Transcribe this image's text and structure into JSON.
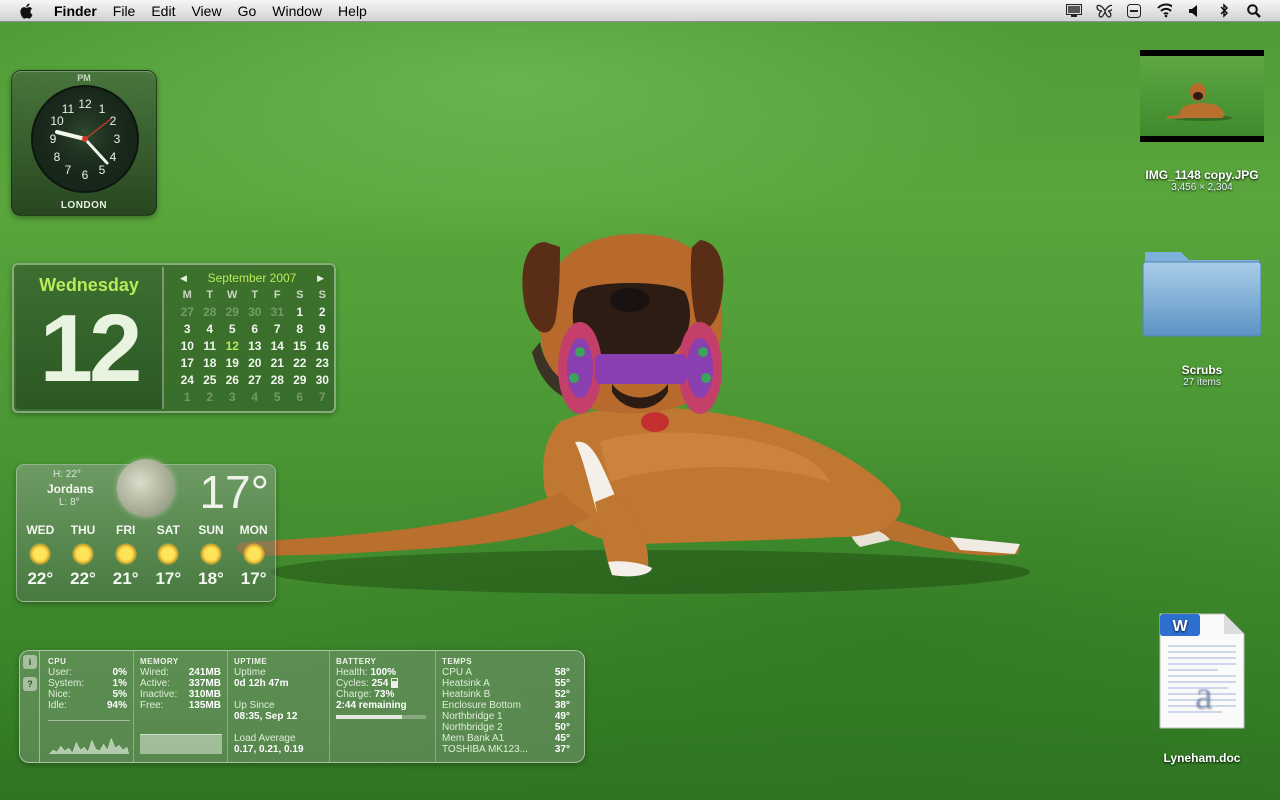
{
  "menubar": {
    "app_name": "Finder",
    "items": [
      "File",
      "Edit",
      "View",
      "Go",
      "Window",
      "Help"
    ],
    "tray_icons": [
      "display-icon",
      "butterfly-icon",
      "eject-icon",
      "wifi-icon",
      "volume-icon",
      "bluetooth-icon",
      "spotlight-icon"
    ]
  },
  "clock": {
    "ampm": "PM",
    "city": "LONDON",
    "numerals": [
      "12",
      "1",
      "2",
      "3",
      "4",
      "5",
      "6",
      "7",
      "8",
      "9",
      "10",
      "11"
    ]
  },
  "calendar": {
    "weekday": "Wednesday",
    "day": "12",
    "month_title": "September 2007",
    "headers": [
      "M",
      "T",
      "W",
      "T",
      "F",
      "S",
      "S"
    ],
    "weeks": [
      [
        "27",
        "28",
        "29",
        "30",
        "31",
        "1",
        "2"
      ],
      [
        "3",
        "4",
        "5",
        "6",
        "7",
        "8",
        "9"
      ],
      [
        "10",
        "11",
        "12",
        "13",
        "14",
        "15",
        "16"
      ],
      [
        "17",
        "18",
        "19",
        "20",
        "21",
        "22",
        "23"
      ],
      [
        "24",
        "25",
        "26",
        "27",
        "28",
        "29",
        "30"
      ],
      [
        "1",
        "2",
        "3",
        "4",
        "5",
        "6",
        "7"
      ]
    ],
    "today": "12"
  },
  "weather": {
    "hi": "H: 22°",
    "location": "Jordans",
    "lo": "L: 8°",
    "current_temp": "17°",
    "forecast": [
      {
        "day": "WED",
        "temp": "22°",
        "icon": "sun-icon"
      },
      {
        "day": "THU",
        "temp": "22°",
        "icon": "sun-icon"
      },
      {
        "day": "FRI",
        "temp": "21°",
        "icon": "sun-icon"
      },
      {
        "day": "SAT",
        "temp": "17°",
        "icon": "sun-icon"
      },
      {
        "day": "SUN",
        "temp": "18°",
        "icon": "sun-icon"
      },
      {
        "day": "MON",
        "temp": "17°",
        "icon": "sun-icon"
      }
    ]
  },
  "istat": {
    "cpu": {
      "title": "CPU",
      "rows": [
        {
          "k": "User:",
          "v": "0%"
        },
        {
          "k": "System:",
          "v": "1%"
        },
        {
          "k": "Nice:",
          "v": "5%"
        },
        {
          "k": "Idle:",
          "v": "94%"
        }
      ]
    },
    "memory": {
      "title": "MEMORY",
      "rows": [
        {
          "k": "Wired:",
          "v": "241MB"
        },
        {
          "k": "Active:",
          "v": "337MB"
        },
        {
          "k": "Inactive:",
          "v": "310MB"
        },
        {
          "k": "Free:",
          "v": "135MB"
        }
      ]
    },
    "uptime": {
      "title": "UPTIME",
      "uptime_label": "Uptime",
      "uptime_value": "0d 12h 47m",
      "since_label": "Up Since",
      "since_value": "08:35, Sep 12",
      "load_label": "Load Average",
      "load_value": "0.17, 0.21, 0.19"
    },
    "battery": {
      "title": "BATTERY",
      "health_label": "Health:",
      "health_value": "100%",
      "cycles_label": "Cycles:",
      "cycles_value": "254",
      "charge_label": "Charge:",
      "charge_value": "73%",
      "remaining": "2:44 remaining",
      "charge_fraction": 0.73
    },
    "temps": {
      "title": "TEMPS",
      "rows": [
        {
          "k": "CPU A",
          "v": "58°"
        },
        {
          "k": "Heatsink A",
          "v": "55°"
        },
        {
          "k": "Heatsink B",
          "v": "52°"
        },
        {
          "k": "Enclosure Bottom",
          "v": "38°"
        },
        {
          "k": "Northbridge 1",
          "v": "49°"
        },
        {
          "k": "Northbridge 2",
          "v": "50°"
        },
        {
          "k": "Mem Bank A1",
          "v": "45°"
        },
        {
          "k": "TOSHIBA MK123...",
          "v": "37°"
        }
      ]
    }
  },
  "desktop": {
    "image": {
      "name": "IMG_1148 copy.JPG",
      "info": "3,456 × 2,304"
    },
    "folder": {
      "name": "Scrubs",
      "info": "27 items"
    },
    "doc": {
      "name": "Lyneham.doc"
    }
  }
}
